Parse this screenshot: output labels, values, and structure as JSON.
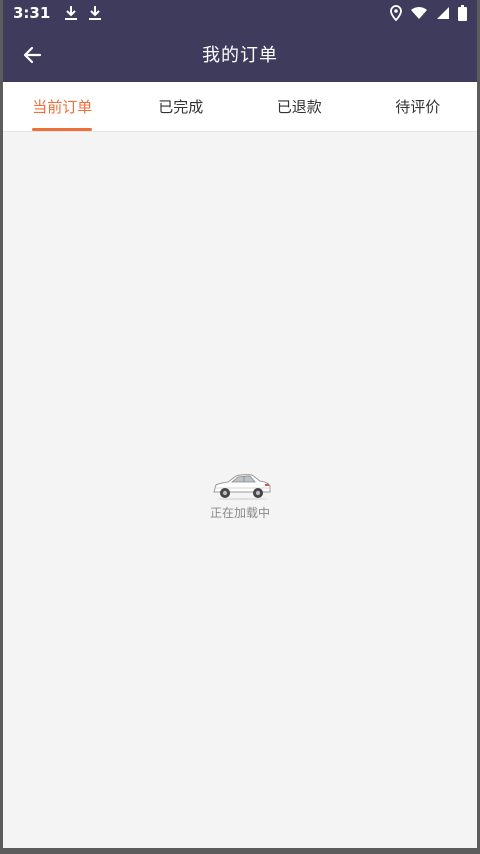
{
  "statusbar": {
    "time": "3:31",
    "icons": [
      "download-icon",
      "download-icon",
      "location-icon",
      "wifi-icon",
      "signal-icon",
      "battery-icon"
    ]
  },
  "appbar": {
    "title": "我的订单",
    "back_icon": "arrow-left-icon"
  },
  "tabs": [
    {
      "label": "当前订单",
      "active": true
    },
    {
      "label": "已完成",
      "active": false
    },
    {
      "label": "已退款",
      "active": false
    },
    {
      "label": "待评价",
      "active": false
    }
  ],
  "loading": {
    "icon": "car-icon",
    "text": "正在加载中"
  },
  "colors": {
    "header": "#3e3b5c",
    "accent": "#ec7038",
    "background": "#f4f4f4"
  }
}
